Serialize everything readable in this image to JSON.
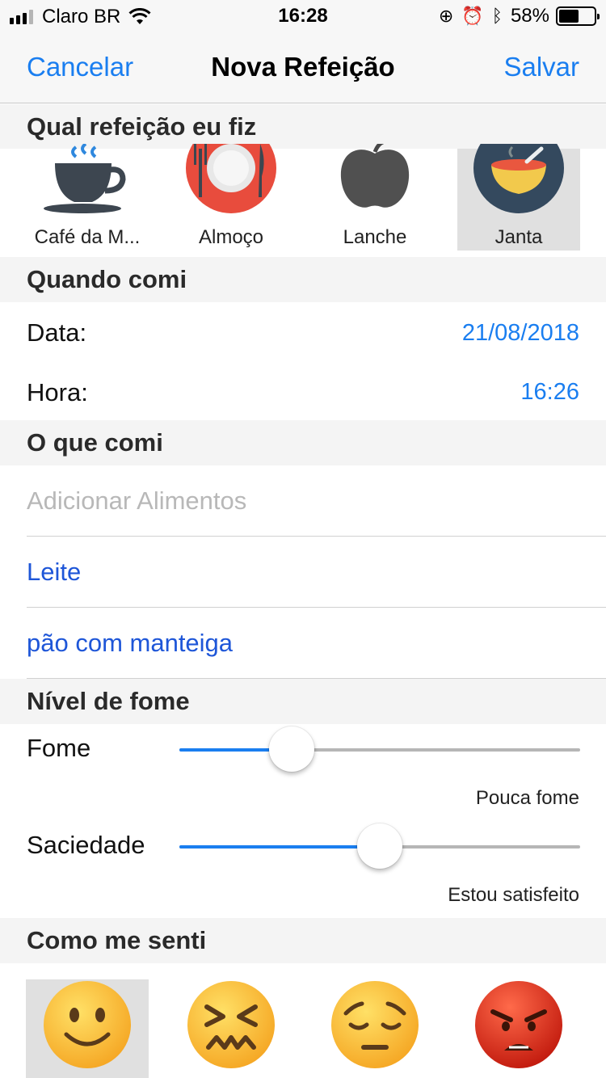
{
  "status_bar": {
    "carrier": "Claro BR",
    "time": "16:28",
    "battery": "58%",
    "battery_level": 0.58
  },
  "nav": {
    "cancel": "Cancelar",
    "title": "Nova Refeição",
    "save": "Salvar"
  },
  "sections": {
    "meal": "Qual refeição eu fiz",
    "when": "Quando comi",
    "what": "O que comi",
    "hunger": "Nível de fome",
    "feeling": "Como me senti"
  },
  "meals": [
    {
      "label": "Café da M...",
      "icon": "coffee-cup-icon",
      "selected": false
    },
    {
      "label": "Almoço",
      "icon": "plate-cutlery-icon",
      "selected": false
    },
    {
      "label": "Lanche",
      "icon": "apple-icon",
      "selected": false
    },
    {
      "label": "Janta",
      "icon": "soup-bowl-icon",
      "selected": true
    }
  ],
  "when": {
    "date_label": "Data:",
    "date_value": "21/08/2018",
    "time_label": "Hora:",
    "time_value": "16:26"
  },
  "foods": {
    "placeholder": "Adicionar Alimentos",
    "items": [
      "Leite",
      "pão com manteiga"
    ]
  },
  "hunger": {
    "fome_label": "Fome",
    "fome_value": 0.28,
    "fome_caption": "Pouca fome",
    "saciedade_label": "Saciedade",
    "saciedade_value": 0.5,
    "saciedade_caption": "Estou satisfeito"
  },
  "feelings": [
    {
      "icon": "slightly-smiling-face-icon",
      "selected": true
    },
    {
      "icon": "confounded-face-icon",
      "selected": false
    },
    {
      "icon": "pensive-face-icon",
      "selected": false
    },
    {
      "icon": "angry-face-icon",
      "selected": false
    }
  ],
  "colors": {
    "accent": "#1a7ef0",
    "food_item": "#1e56d8",
    "section_bg": "#f4f4f4"
  }
}
